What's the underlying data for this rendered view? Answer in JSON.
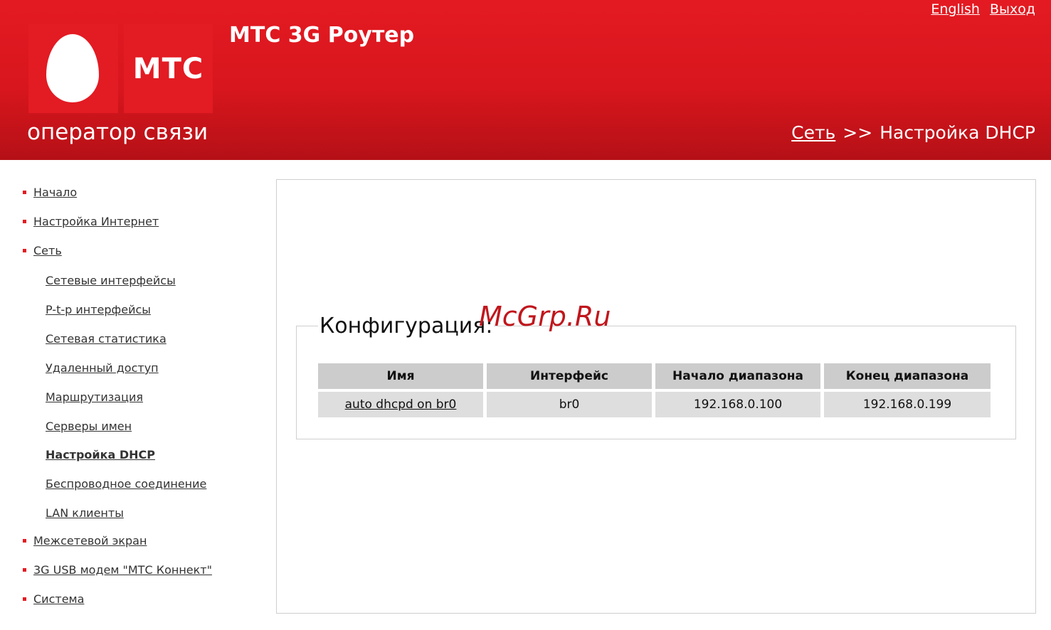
{
  "header": {
    "logo_text": "МТС",
    "tagline": "оператор связи",
    "app_title": "МТС 3G Роутер",
    "links": {
      "english": "English",
      "logout": "Выход"
    },
    "breadcrumb": {
      "parent": "Сеть",
      "separator": ">>",
      "current": "Настройка DHCP"
    }
  },
  "sidebar": {
    "items": [
      {
        "label": "Начало"
      },
      {
        "label": "Настройка Интернет"
      },
      {
        "label": "Сеть"
      },
      {
        "label": "Межсетевой экран"
      },
      {
        "label": "3G USB модем \"МТС Коннект\""
      },
      {
        "label": "Система"
      }
    ],
    "subitems": [
      {
        "label": "Сетевые интерфейсы"
      },
      {
        "label": "P-t-p интерфейсы"
      },
      {
        "label": "Сетевая статистика"
      },
      {
        "label": "Удаленный доступ"
      },
      {
        "label": "Маршрутизация"
      },
      {
        "label": "Серверы имен"
      },
      {
        "label": "Настройка DHCP"
      },
      {
        "label": "Беспроводное соединение"
      },
      {
        "label": "LAN клиенты"
      }
    ]
  },
  "main": {
    "section_title": "Конфигурация:",
    "watermark": "McGrp.Ru",
    "table": {
      "headers": [
        "Имя",
        "Интерфейс",
        "Начало диапазона",
        "Конец диапазона"
      ],
      "rows": [
        [
          "auto dhcpd on br0",
          "br0",
          "192.168.0.100",
          "192.168.0.199"
        ]
      ]
    }
  },
  "colors": {
    "brand_red": "#e31b23",
    "header_dark_red": "#b51017"
  }
}
